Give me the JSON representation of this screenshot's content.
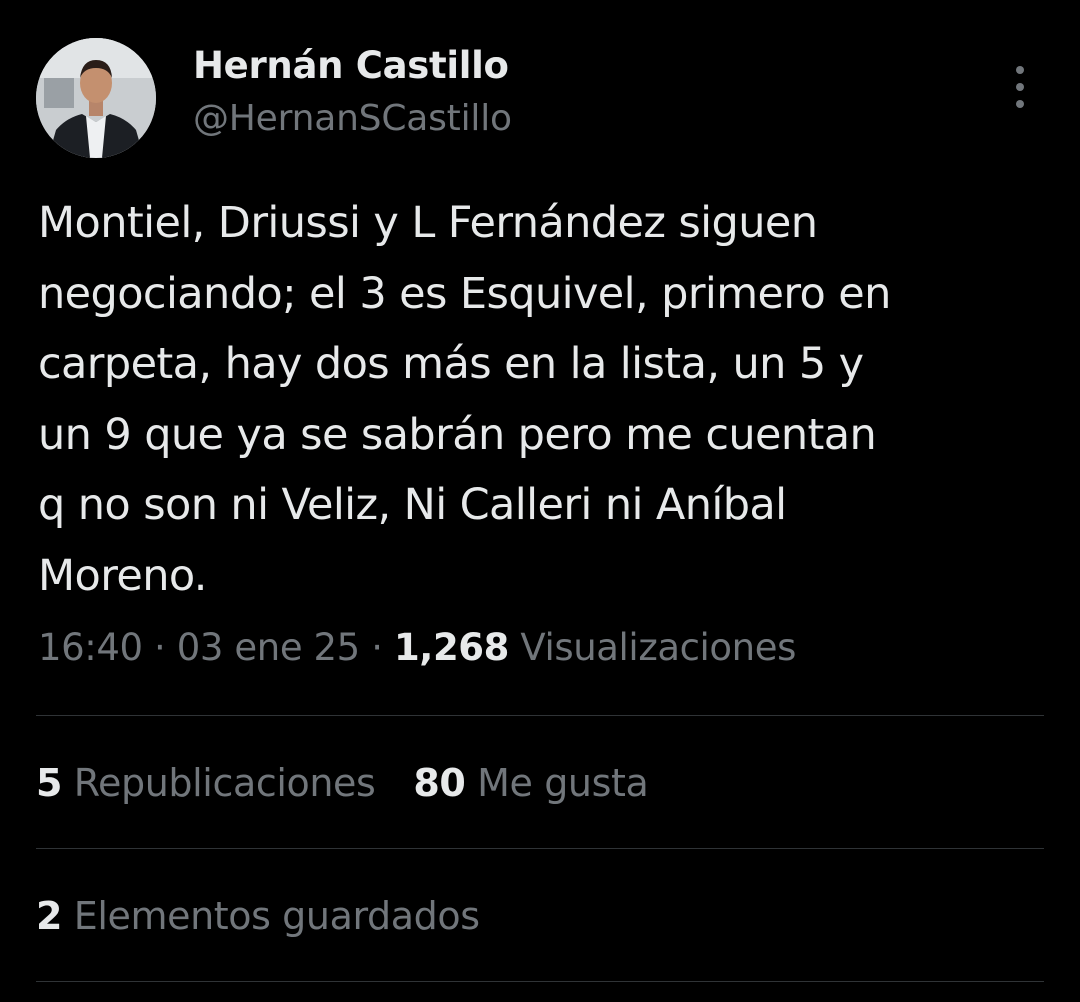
{
  "author": {
    "name": "Hernán Castillo",
    "handle": "@HernanSCastillo"
  },
  "tweet": {
    "text": "Montiel, Driussi y L Fernández siguen\nnegociando; el 3 es Esquivel, primero en\ncarpeta, hay dos más en la lista, un 5 y\nun 9 que ya se sabrán pero me cuentan\nq no son ni Veliz, Ni Calleri ni Aníbal\nMoreno.",
    "time": "16:40",
    "date": "03 ene 25",
    "separator": "·",
    "views_count": "1,268",
    "views_label": "Visualizaciones"
  },
  "stats": {
    "reposts_count": "5",
    "reposts_label": "Republicaciones",
    "likes_count": "80",
    "likes_label": "Me gusta",
    "bookmarks_count": "2",
    "bookmarks_label": "Elementos guardados"
  },
  "icons": {
    "more": "more-options-icon"
  },
  "colors": {
    "background": "#000000",
    "text_primary": "#e7e9ea",
    "text_secondary": "#71767b",
    "divider": "#2f3336"
  }
}
